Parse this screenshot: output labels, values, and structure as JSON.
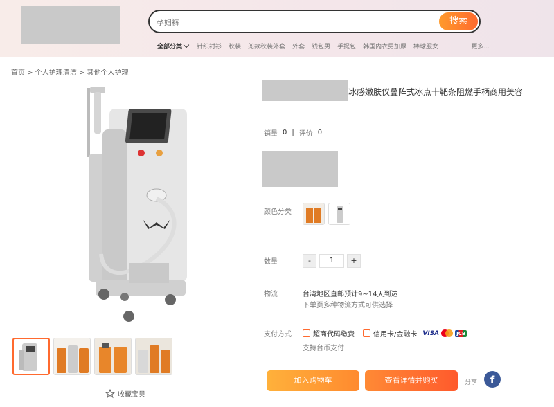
{
  "header": {
    "search_text": "孕妇裤",
    "search_button": "搜索",
    "nav_all": "全部分类",
    "nav_items": [
      "针织衬衫",
      "秋装",
      "兜款秋装外套",
      "外套",
      "钱包男",
      "手提包",
      "韩国内衣男加厚",
      "棒球服女"
    ],
    "nav_more": "更多..."
  },
  "breadcrumb": {
    "items": [
      "首页",
      "个人护理清洁",
      "其他个人护理"
    ],
    "sep": ">"
  },
  "product": {
    "title": "冰感嫩肤仪叠阵式冰点十靶条阻燃手柄商用美容",
    "sales_label": "销量",
    "sales_value": "0",
    "divider": "|",
    "reviews_label": "评价",
    "reviews_value": "0",
    "color_label": "颜色分类",
    "qty_label": "数量",
    "qty_minus": "-",
    "qty_value": "1",
    "qty_plus": "+",
    "shipping_label": "物流",
    "shipping_line1": "台湾地区直邮预计9~14天到达",
    "shipping_line2": "下单页多种物流方式可供选择",
    "payment_label": "支付方式",
    "payment_option1": "超商代码缴费",
    "payment_option2": "信用卡/金融卡",
    "payment_note": "支持台币支付",
    "card_visa": "VISA",
    "card_jcb": "JCB",
    "add_to_cart": "加入购物车",
    "buy_now": "查看详情并购买",
    "share_label": "分享",
    "favorite": "收藏宝贝"
  },
  "colors": {
    "accent": "#ff6a2f",
    "accent_light": "#ffa135",
    "facebook": "#3b5998"
  },
  "icons": [
    "chevron-down-icon",
    "star-icon",
    "facebook-icon",
    "store-icon",
    "card-icon",
    "mastercard-icon"
  ]
}
